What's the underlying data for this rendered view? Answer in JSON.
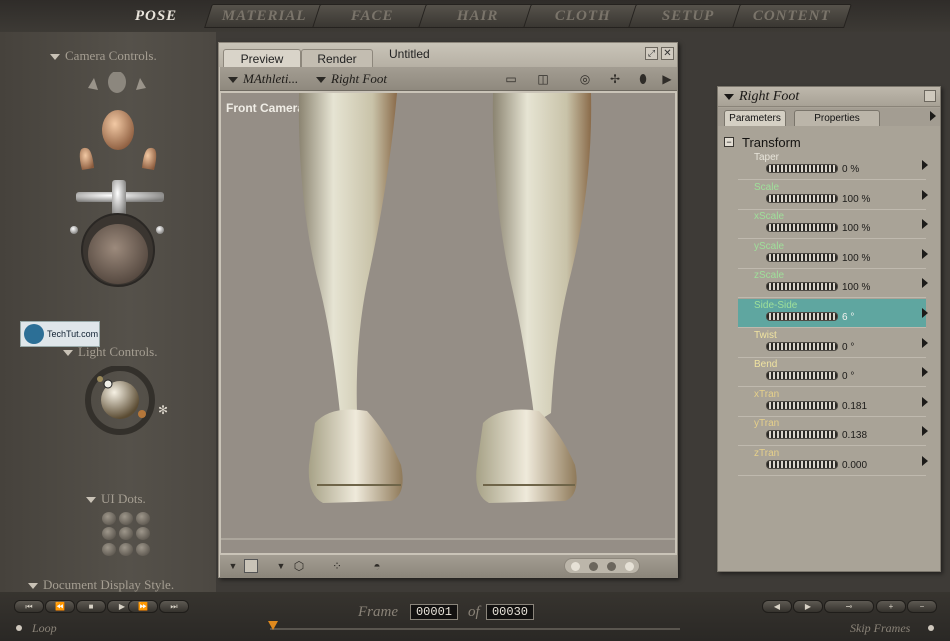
{
  "top_tabs": [
    "POSE",
    "MATERIAL",
    "FACE",
    "HAIR",
    "CLOTH",
    "SETUP",
    "CONTENT"
  ],
  "left": {
    "camera_controls": "Camera Controls.",
    "light_controls": "Light Controls.",
    "ui_dots": "UI Dots.",
    "document_display_style": "Document Display Style.",
    "watermark": "TechTut.com"
  },
  "document": {
    "tabs": [
      "Preview",
      "Render"
    ],
    "title": "Untitled",
    "figure_menu": "MAthleti...",
    "actor_menu": "Right Foot",
    "camera_label": "Front Camera"
  },
  "params_panel": {
    "title": "Right Foot",
    "tabs": [
      "Parameters",
      "Properties"
    ],
    "group": "Transform",
    "items": [
      {
        "name": "Taper",
        "value": "0 %"
      },
      {
        "name": "Scale",
        "value": "100 %"
      },
      {
        "name": "xScale",
        "value": "100 %"
      },
      {
        "name": "yScale",
        "value": "100 %"
      },
      {
        "name": "zScale",
        "value": "100 %"
      },
      {
        "name": "Side-Side",
        "value": "6 °"
      },
      {
        "name": "Twist",
        "value": "0 °"
      },
      {
        "name": "Bend",
        "value": "0 °"
      },
      {
        "name": "xTran",
        "value": "0.181"
      },
      {
        "name": "yTran",
        "value": "0.138"
      },
      {
        "name": "zTran",
        "value": "0.000"
      }
    ],
    "selected_index": 5,
    "name_colors": [
      "#e8e4da",
      "#9fe09a",
      "#9fe09a",
      "#9fe09a",
      "#9fe09a",
      "#9fe09a",
      "#f0e3a0",
      "#f0e3a0",
      "#e6d08a",
      "#e6d08a",
      "#e6d08a"
    ]
  },
  "bottom": {
    "frame_label": "Frame",
    "frame_current": "00001",
    "of_label": "of",
    "frame_total": "00030",
    "loop_label": "Loop",
    "skip_frames_label": "Skip Frames"
  },
  "colors": {
    "selected_row": "#5fa6a0",
    "timeline_marker": "#e08a1e"
  }
}
